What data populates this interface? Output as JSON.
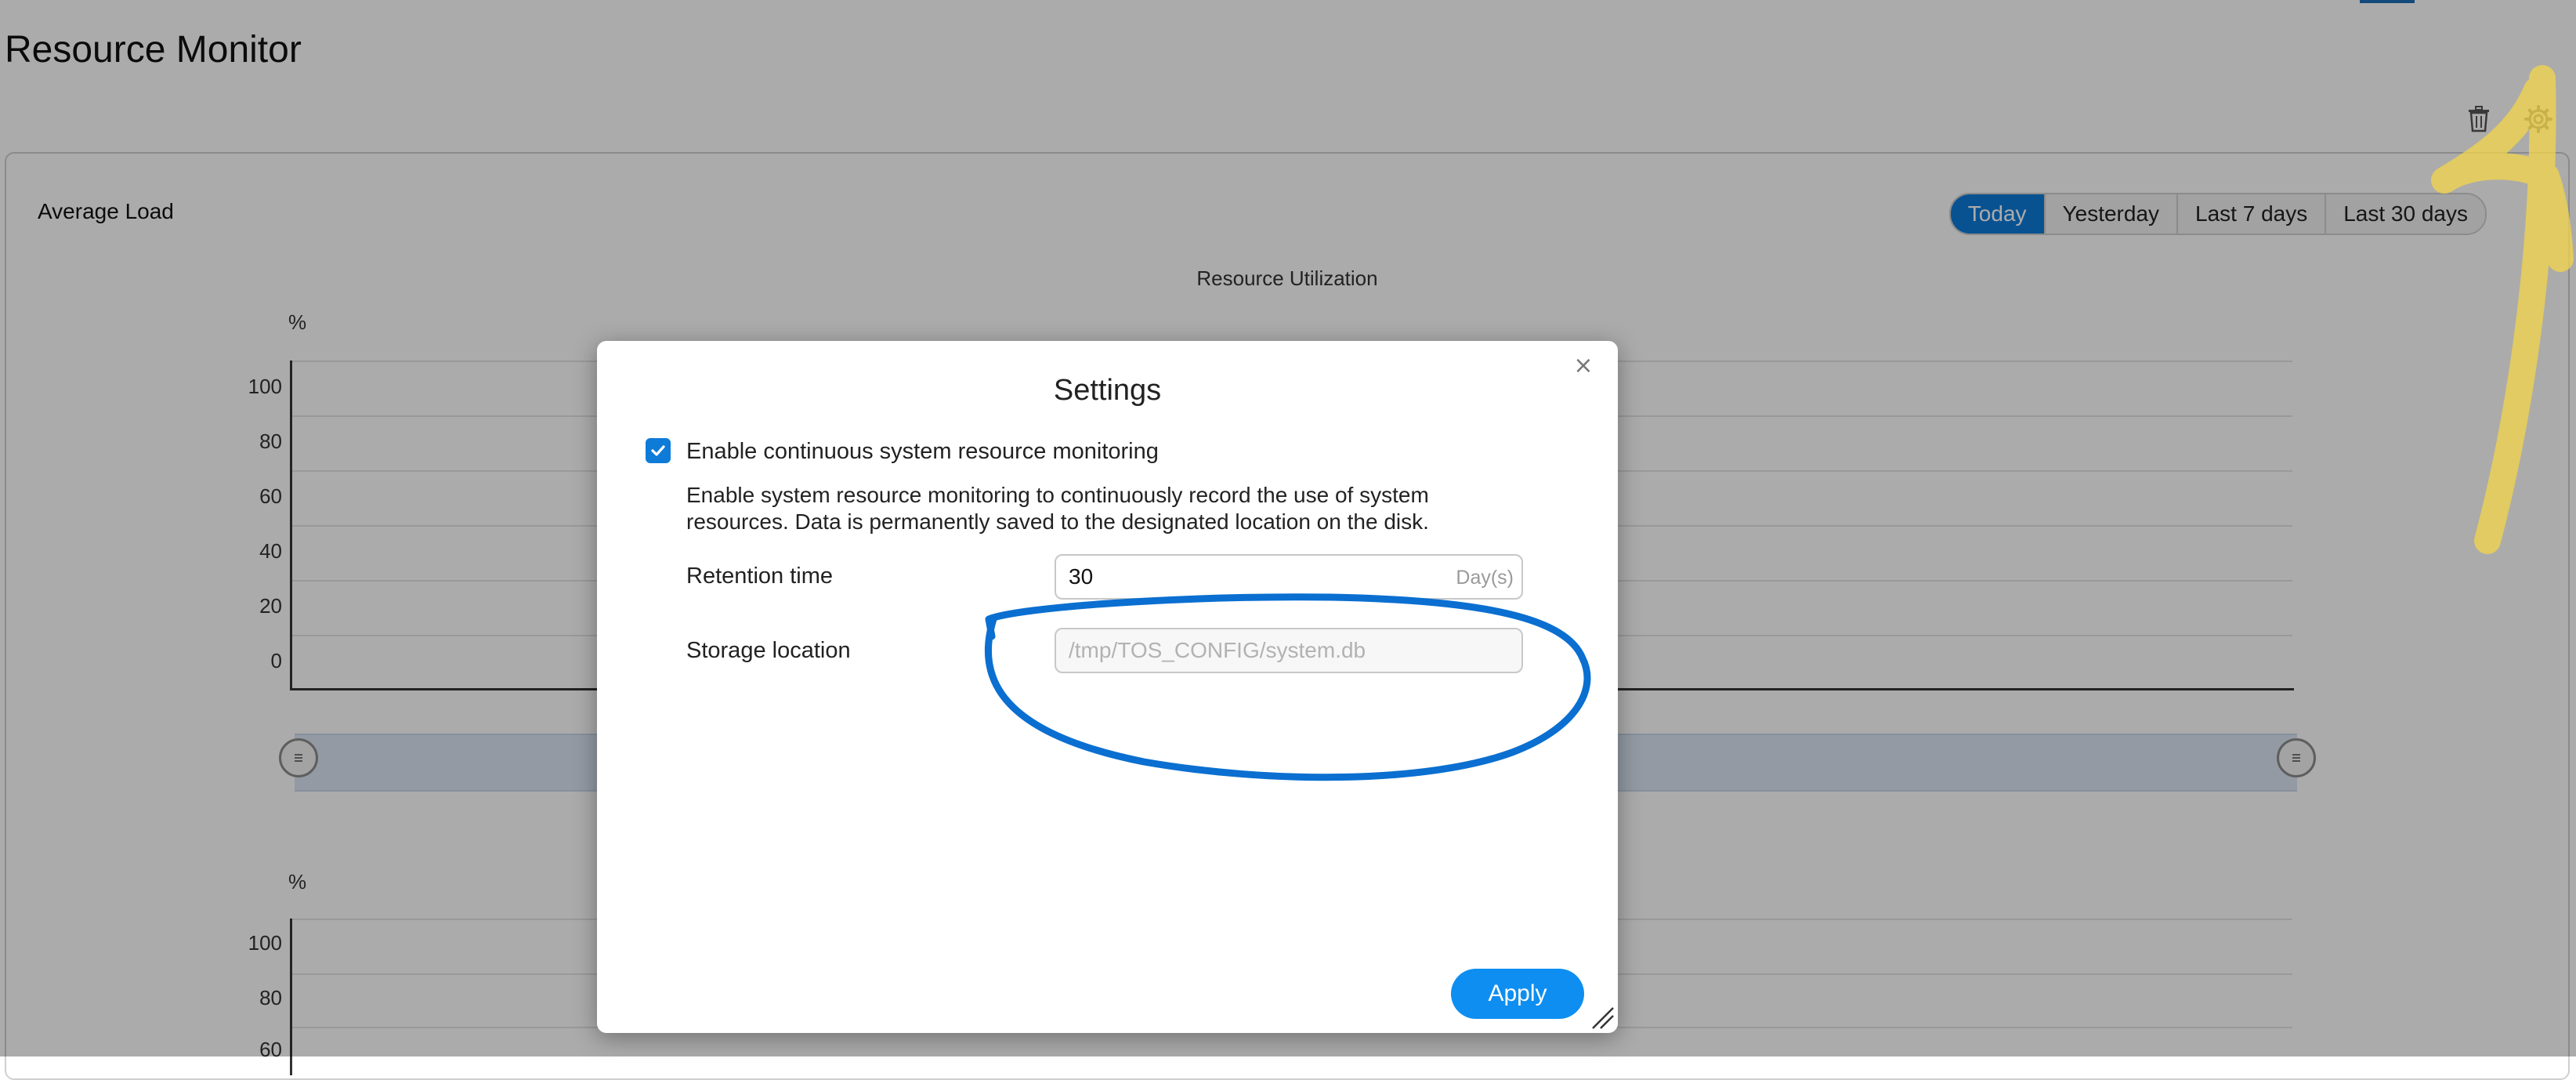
{
  "page": {
    "title": "Resource Monitor"
  },
  "panel": {
    "title": "Average Load",
    "ranges": [
      {
        "label": "Today",
        "active": true
      },
      {
        "label": "Yesterday",
        "active": false
      },
      {
        "label": "Last 7 days",
        "active": false
      },
      {
        "label": "Last 30 days",
        "active": false
      }
    ]
  },
  "chart_data": [
    {
      "type": "line",
      "title": "Resource Utilization",
      "ylabel": "%",
      "yticks": [
        "100",
        "80",
        "60",
        "40",
        "20",
        "0"
      ],
      "ylim": [
        0,
        100
      ],
      "series": []
    },
    {
      "type": "line",
      "title": "",
      "ylabel": "%",
      "yticks": [
        "100",
        "80",
        "60"
      ],
      "ylim": [
        0,
        100
      ],
      "series": []
    }
  ],
  "dialog": {
    "title": "Settings",
    "close_symbol": "×",
    "checkbox": {
      "checked": true,
      "label": "Enable continuous system resource monitoring"
    },
    "description_line1": "Enable system resource monitoring to continuously record the use of system",
    "description_line2": "resources. Data is permanently saved to the designated location on the disk.",
    "retention": {
      "label": "Retention time",
      "value": "30",
      "suffix": "Day(s)"
    },
    "storage": {
      "label": "Storage location",
      "placeholder": "/tmp/TOS_CONFIG/system.db"
    },
    "apply_label": "Apply"
  },
  "icons": {
    "trash": "trash-icon",
    "gear": "gear-icon",
    "close": "close-icon",
    "check": "check-icon",
    "resize": "resize-handle-icon"
  },
  "colors": {
    "accent": "#0e7bd9",
    "apply_button": "#0e8ef0",
    "annotation_blue": "#0a6fd0",
    "annotation_yellow": "#f3d64a"
  }
}
